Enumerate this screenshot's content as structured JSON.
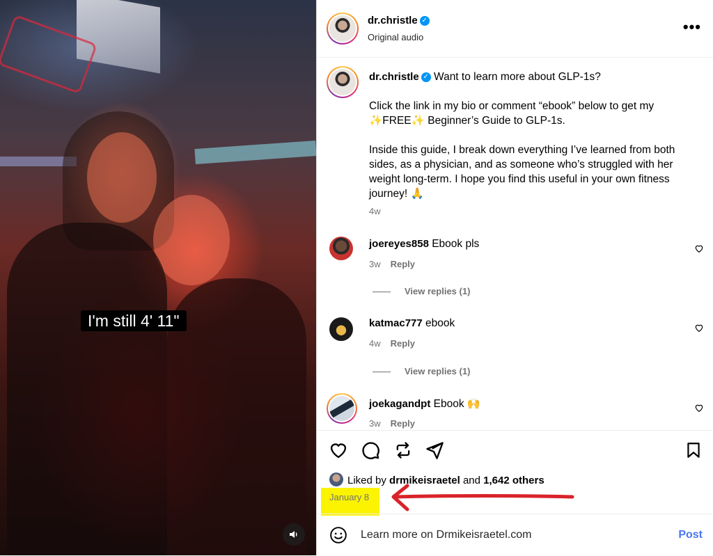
{
  "video": {
    "caption_text": "I'm still 4' 11\"",
    "volume_icon": "speaker-icon"
  },
  "header": {
    "username": "dr.christle",
    "subtitle": "Original audio",
    "more_icon": "more-options-icon"
  },
  "post": {
    "username": "dr.christle",
    "line1": "Want to learn more about GLP-1s?",
    "line2": "Click the link in my bio or comment “ebook” below to get my",
    "line3": "✨FREE✨ Beginner’s Guide to GLP-1s.",
    "line4": "Inside this guide, I break down everything I’ve learned from both",
    "line5": "sides, as a physician, and as someone who’s struggled with her",
    "line6": "weight long-term. I hope you find this useful in your own fitness",
    "line7": "journey! 🙏",
    "time": "4w"
  },
  "comments": [
    {
      "username": "joereyes858",
      "text": "Ebook pls",
      "time": "3w",
      "reply": "Reply",
      "view_replies": "View replies (1)"
    },
    {
      "username": "katmac777",
      "text": "ebook",
      "time": "4w",
      "reply": "Reply",
      "view_replies": "View replies (1)"
    },
    {
      "username": "joekagandpt",
      "text": "Ebook 🙌",
      "time": "3w",
      "reply": "Reply"
    }
  ],
  "likes": {
    "prefix": "Liked by",
    "user": "drmikeisraetel",
    "middle": "and",
    "count": "1,642 others"
  },
  "date": "January 8",
  "add_comment": {
    "text": "Learn more on Drmikeisraetel.com",
    "post_label": "Post"
  },
  "colors": {
    "verified": "#0095f6",
    "post_button": "#4c76f0",
    "highlight": "#fbf300",
    "arrow": "#d9232a"
  }
}
